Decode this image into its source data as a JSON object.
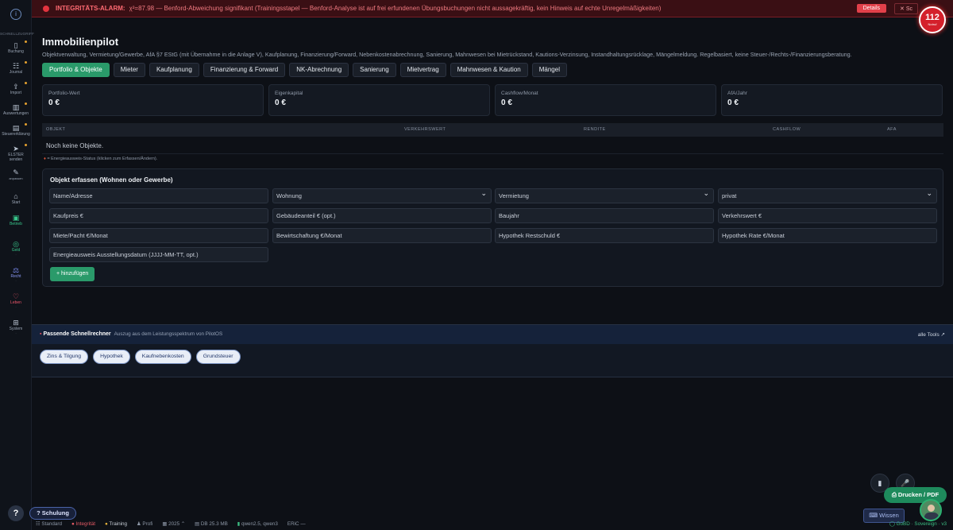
{
  "alarm": {
    "title": "INTEGRITÄTS-ALARM:",
    "message": "χ²=87.98 — Benford-Abweichung signifikant (Trainingsstapel — Benford-Analyse ist auf frei erfundenen Übungsbuchungen nicht aussagekräftig, kein Hinweis auf echte Unregelmäßigkeiten)",
    "details": "Details",
    "close": "✕ Sc"
  },
  "notruf": {
    "number": "112",
    "label": "Notruf"
  },
  "sidebar": {
    "caption": "SCHNELLZUGRIFF",
    "items": [
      {
        "label": "Buchung",
        "icon": "▯"
      },
      {
        "label": "Journal",
        "icon": "☷"
      },
      {
        "label": "Import",
        "icon": "⇪"
      },
      {
        "label": "Auswertungen",
        "icon": "▥"
      },
      {
        "label": "Steuererklärung",
        "icon": "▤"
      },
      {
        "label": "ELSTER senden",
        "icon": "➤"
      },
      {
        "label": "anpassen",
        "icon": "✎"
      },
      {
        "label": "Start",
        "icon": "⌂"
      },
      {
        "label": "Betrieb",
        "icon": "▣"
      },
      {
        "label": "Geld",
        "icon": "◎"
      },
      {
        "label": "Recht",
        "icon": "⚖"
      },
      {
        "label": "Leben",
        "icon": "♡"
      },
      {
        "label": "System",
        "icon": "⊞"
      }
    ],
    "help": "?"
  },
  "page": {
    "title": "Immobilienpilot",
    "subtitle": "Objektverwaltung, Vermietung/Gewerbe, AfA §7 EStG (mit Übernahme in die Anlage V), Kaufplanung, Finanzierung/Forward, Nebenkostenabrechnung, Sanierung, Mahnwesen bei Mietrückstand, Kautions-Verzinsung, Instandhaltungsrücklage, Mängelmeldung. Regelbasiert, keine Steuer-/Rechts-/Finanzierungsberatung."
  },
  "tabs": [
    "Portfolio & Objekte",
    "Mieter",
    "Kaufplanung",
    "Finanzierung & Forward",
    "NK-Abrechnung",
    "Sanierung",
    "Mietvertrag",
    "Mahnwesen & Kaution",
    "Mängel"
  ],
  "kpis": [
    {
      "label": "Portfolio-Wert",
      "value": "0 €"
    },
    {
      "label": "Eigenkapital",
      "value": "0 €"
    },
    {
      "label": "Cashflow/Monat",
      "value": "0 €"
    },
    {
      "label": "AfA/Jahr",
      "value": "0 €"
    }
  ],
  "table": {
    "columns": [
      "OBJEKT",
      "VERKEHRSWERT",
      "RENDITE",
      "CASHFLOW",
      "AFA"
    ],
    "empty": "Noch keine Objekte.",
    "legend": "= Energieausweis-Status (klicken zum Erfassen/Ändern)."
  },
  "form": {
    "title": "Objekt erfassen (Wohnen oder Gewerbe)",
    "name": "Name/Adresse",
    "type": "Wohnung",
    "usage": "Vermietung",
    "owner": "privat",
    "kaufpreis": "Kaufpreis €",
    "gebaeude": "Gebäudeanteil € (opt.)",
    "baujahr": "Baujahr",
    "verkehrswert": "Verkehrswert €",
    "miete": "Miete/Pacht €/Monat",
    "bewirtschaftung": "Bewirtschaftung €/Monat",
    "restschuld": "Hypothek Restschuld €",
    "rate": "Hypothek Rate €/Monat",
    "energie": "Energieausweis Ausstellungsdatum (JJJJ-MM-TT, opt.)",
    "add": "+ hinzufügen"
  },
  "schnellrechner": {
    "title": "Passende Schnellrechner",
    "subtitle": "Auszug aus dem Leistungsspektrum von PilotOS",
    "all": "alle Tools ↗",
    "chips": [
      "Zins & Tilgung",
      "Hypothek",
      "Kaufnebenkosten",
      "Grundsteuer"
    ]
  },
  "bottom": {
    "print": "⎙ Drucken / PDF",
    "schulung": "? Schulung",
    "wissen": "⌨ Wissen",
    "doc_icon": "▮",
    "mic_icon": "🎤"
  },
  "status": {
    "standard": "Standard",
    "integritaet": "Integrität",
    "training": "Training",
    "profil": "Profi",
    "year": "2025 ⌃",
    "db": "DB 25.3 MB",
    "models": "qwen2.5, qwen3",
    "eric": "ERiC —",
    "sovereign": "GoBD · Sovereign · v3"
  }
}
